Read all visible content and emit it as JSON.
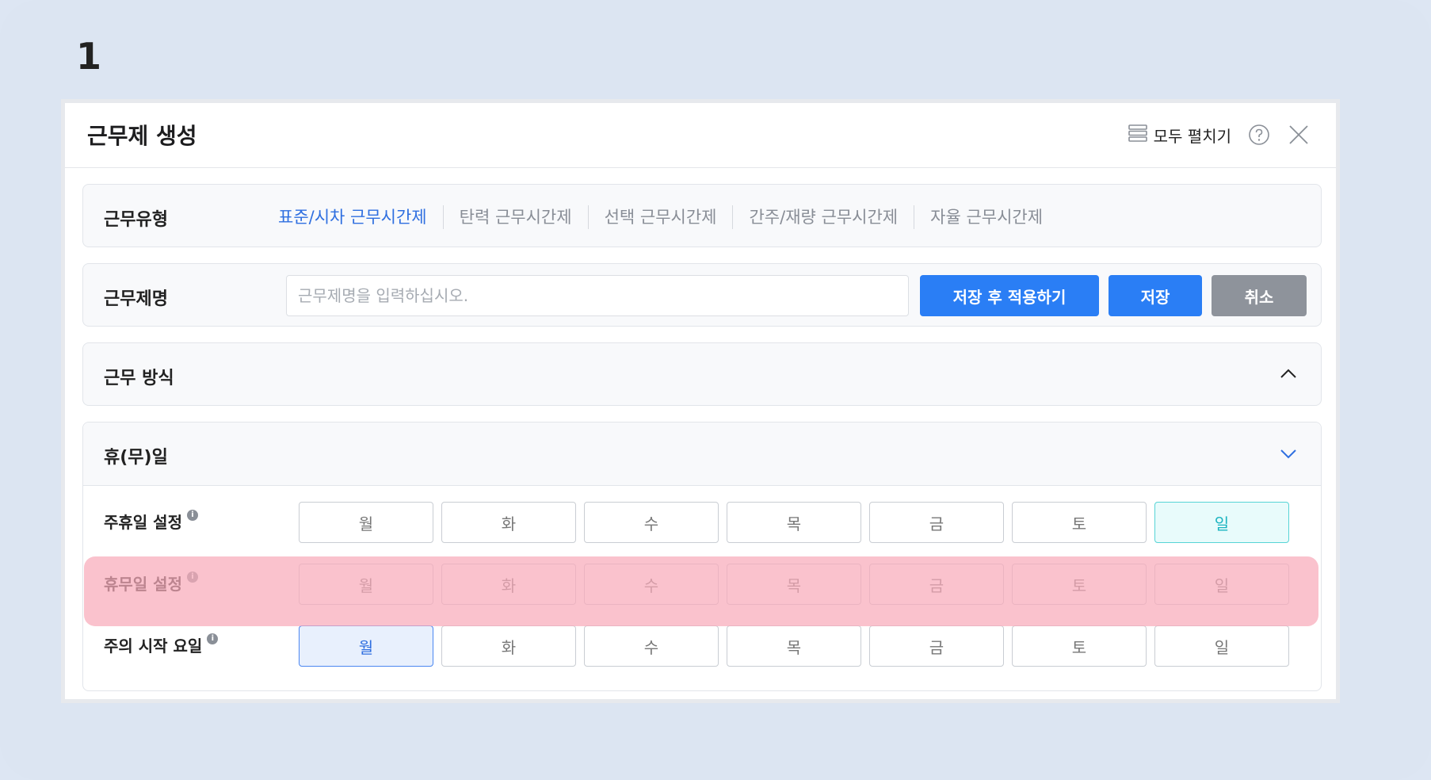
{
  "step": {
    "number": "1"
  },
  "modal": {
    "title": "근무제 생성",
    "expand_all_label": "모두 펼치기"
  },
  "work_type": {
    "label": "근무유형",
    "tabs": [
      {
        "label": "표준/시차 근무시간제",
        "active": true
      },
      {
        "label": "탄력 근무시간제",
        "active": false
      },
      {
        "label": "선택 근무시간제",
        "active": false
      },
      {
        "label": "간주/재량 근무시간제",
        "active": false
      },
      {
        "label": "자율 근무시간제",
        "active": false
      }
    ]
  },
  "work_name": {
    "label": "근무제명",
    "placeholder": "근무제명을 입력하십시오.",
    "value": "",
    "save_apply_label": "저장 후 적용하기",
    "save_label": "저장",
    "cancel_label": "취소"
  },
  "work_method": {
    "label": "근무 방식",
    "expanded": true
  },
  "holiday": {
    "label": "휴(무)일",
    "expanded": true,
    "days": [
      "월",
      "화",
      "수",
      "목",
      "금",
      "토",
      "일"
    ],
    "rows": [
      {
        "label": "주휴일 설정",
        "selected": "일"
      },
      {
        "label": "휴무일 설정",
        "selected": ""
      },
      {
        "label": "주의 시작 요일",
        "selected": "월"
      }
    ]
  },
  "colors": {
    "accent": "#2a7ef5",
    "cancel": "#8e939b",
    "highlight": "#f8aaba",
    "weekly_selected": "#56d4d6"
  }
}
